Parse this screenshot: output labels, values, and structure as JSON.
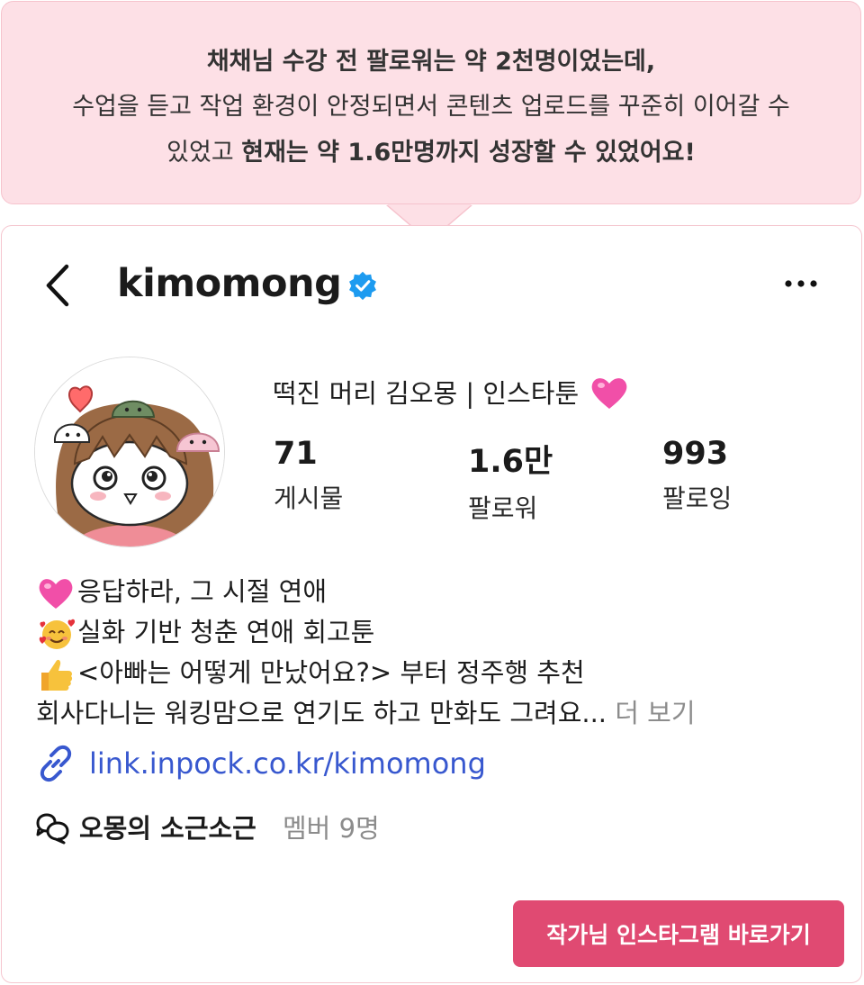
{
  "bubble": {
    "line1": "채채님 수강 전 팔로워는 약 2천명이었는데,",
    "line2": "수업을 듣고 작업 환경이 안정되면서 콘텐츠 업로드를 꾸준히 이어갈 수",
    "line3_prefix": "있었고 ",
    "line3_bold": "현재는 약 1.6만명까지 성장할 수 있었어요!"
  },
  "profile": {
    "username": "kimomong",
    "display_name": "떡진 머리 김오몽 | 인스타툰",
    "stats": [
      {
        "value": "71",
        "label": "게시물"
      },
      {
        "value": "1.6만",
        "label": "팔로워"
      },
      {
        "value": "993",
        "label": "팔로잉"
      }
    ],
    "bio": [
      {
        "icon": "pink-heart-icon",
        "text": "응답하라, 그 시절 연애"
      },
      {
        "icon": "smiling-face-with-hearts-icon",
        "text": "실화 기반 청춘 연애 회고툰"
      },
      {
        "icon": "thumbs-up-icon",
        "text": "<아빠는 어떻게 만났어요?> 부터 정주행 추천"
      },
      {
        "text": "회사다니는 워킹맘으로 연기도 하고 만화도 그려요...",
        "more": "더 보기"
      }
    ],
    "link": "link.inpock.co.kr/kimomong",
    "channel": {
      "name": "오몽의 소근소근",
      "members": "멤버 9명"
    }
  },
  "cta": {
    "label": "작가님 인스타그램 바로가기"
  },
  "colors": {
    "bubble_bg": "#fde0e6",
    "card_border": "#f5c6cf",
    "cta_bg": "#e04a72",
    "link": "#3858cf",
    "verified": "#1d9bf0"
  }
}
